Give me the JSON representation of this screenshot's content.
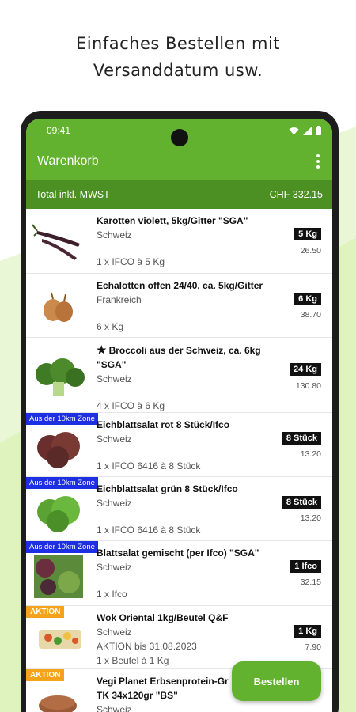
{
  "headline": {
    "line1": "Einfaches Bestellen mit",
    "line2": "Versanddatum usw."
  },
  "status_bar": {
    "time": "09:41",
    "icons": [
      "wifi-icon",
      "signal-icon",
      "battery-icon"
    ]
  },
  "app_bar": {
    "title": "Warenkorb",
    "menu_icon": "more-vert-icon"
  },
  "total_bar": {
    "label": "Total inkl. MWST",
    "value": "CHF 332.15"
  },
  "items": [
    {
      "name": "Karotten violett, 5kg/Gitter \"SGA\"",
      "origin": "Schweiz",
      "extra": "",
      "quantity": "1 x IFCO à 5 Kg",
      "unit": "5 Kg",
      "price": "26.50",
      "badge": "",
      "star": ""
    },
    {
      "name": "Echalotten offen 24/40, ca. 5kg/Gitter",
      "origin": "Frankreich",
      "extra": "",
      "quantity": "6 x Kg",
      "unit": "6 Kg",
      "price": "38.70",
      "badge": "",
      "star": ""
    },
    {
      "name": "Broccoli aus der Schweiz, ca. 6kg \"SGA\"",
      "origin": "Schweiz",
      "extra": "",
      "quantity": "4 x IFCO à 6 Kg",
      "unit": "24 Kg",
      "price": "130.80",
      "badge": "",
      "star": "★"
    },
    {
      "name": "Eichblattsalat rot  8 Stück/Ifco",
      "origin": "Schweiz",
      "extra": "",
      "quantity": "1 x IFCO 6416 à 8 Stück",
      "unit": "8 Stück",
      "price": "13.20",
      "badge": "Aus der 10km Zone",
      "star": ""
    },
    {
      "name": "Eichblattsalat grün 8 Stück/Ifco",
      "origin": "Schweiz",
      "extra": "",
      "quantity": "1 x IFCO 6416 à 8 Stück",
      "unit": "8 Stück",
      "price": "13.20",
      "badge": "Aus der 10km Zone",
      "star": ""
    },
    {
      "name": "Blattsalat gemischt (per Ifco) \"SGA\"",
      "origin": "Schweiz",
      "extra": "",
      "quantity": "1 x Ifco",
      "unit": "1 Ifco",
      "price": "32.15",
      "badge": "Aus der 10km Zone",
      "star": ""
    },
    {
      "name": "Wok Oriental 1kg/Beutel Q&F",
      "origin": "Schweiz",
      "extra": "AKTION bis 31.08.2023",
      "quantity": "1 x Beutel à 1 Kg",
      "unit": "1 Kg",
      "price": "7.90",
      "badge": "AKTION",
      "star": ""
    },
    {
      "name": "Vegi Planet Erbsenprotein-Gr",
      "name2": "TK 34x120gr \"BS\"",
      "origin": "Schweiz",
      "extra": "",
      "quantity": "",
      "unit": "",
      "price": "",
      "badge": "AKTION",
      "star": ""
    }
  ],
  "fab": {
    "label": "Bestellen"
  },
  "colors": {
    "primary": "#62b22f",
    "primary_dark": "#4c8f22",
    "zone_badge": "#1d2fe0",
    "aktion_badge": "#f5a31a"
  }
}
